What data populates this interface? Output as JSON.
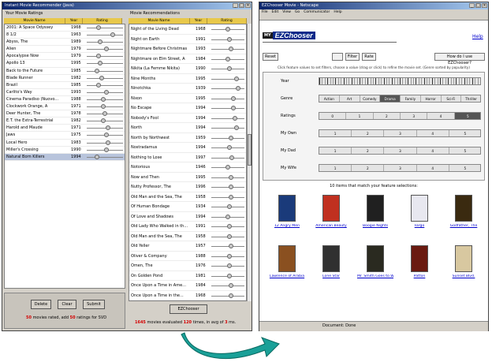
{
  "left_window": {
    "title": "Instant Movie Recommender (Java)",
    "your_ratings": {
      "heading": "Your Movie Ratings",
      "columns": [
        "Movie Name",
        "Year",
        "Rating"
      ],
      "rows": [
        {
          "name": "2001: A Space Odyssey",
          "year": "1968",
          "rating": 0.3
        },
        {
          "name": "8 1/2",
          "year": "1963",
          "rating": 0.75
        },
        {
          "name": "Abyss, The",
          "year": "1989",
          "rating": 0.35
        },
        {
          "name": "Alien",
          "year": "1979",
          "rating": 0.55
        },
        {
          "name": "Apocalypse Now",
          "year": "1979",
          "rating": 0.3
        },
        {
          "name": "Apollo 13",
          "year": "1995",
          "rating": 0.35
        },
        {
          "name": "Back to the Future",
          "year": "1985",
          "rating": 0.25
        },
        {
          "name": "Blade Runner",
          "year": "1982",
          "rating": 0.4
        },
        {
          "name": "Brazil",
          "year": "1985",
          "rating": 0.3
        },
        {
          "name": "Carlito's Way",
          "year": "1993",
          "rating": 0.55
        },
        {
          "name": "Cinema Paradiso (Nuovo...",
          "year": "1988",
          "rating": 0.45
        },
        {
          "name": "Clockwork Orange, A",
          "year": "1971",
          "rating": 0.45
        },
        {
          "name": "Deer Hunter, The",
          "year": "1978",
          "rating": 0.5
        },
        {
          "name": "E.T. the Extra-Terrestrial",
          "year": "1982",
          "rating": 0.45
        },
        {
          "name": "Harold and Maude",
          "year": "1971",
          "rating": 0.6
        },
        {
          "name": "Jaws",
          "year": "1975",
          "rating": 0.55
        },
        {
          "name": "Local Hero",
          "year": "1983",
          "rating": 0.6
        },
        {
          "name": "Miller's Crossing",
          "year": "1990",
          "rating": 0.55
        },
        {
          "name": "Natural Born Killers",
          "year": "1994",
          "rating": 0.25
        }
      ],
      "selected_index": 18
    },
    "recommendations": {
      "heading": "Movie Recommendations",
      "columns": [
        "Movie Name",
        "Year",
        "Rating"
      ],
      "rows": [
        {
          "name": "Night of the Living Dead",
          "year": "1968",
          "rating": 0.5
        },
        {
          "name": "Night on Earth",
          "year": "1991",
          "rating": 0.55
        },
        {
          "name": "Nightmare Before Christmas",
          "year": "1993",
          "rating": 0.6
        },
        {
          "name": "Nightmare on Elm Street, A",
          "year": "1984",
          "rating": 0.5
        },
        {
          "name": "Nikita (La Femme Nikita)",
          "year": "1990",
          "rating": 0.55
        },
        {
          "name": "Nine Months",
          "year": "1995",
          "rating": 0.8
        },
        {
          "name": "Ninotchka",
          "year": "1939",
          "rating": 0.85
        },
        {
          "name": "Nixon",
          "year": "1995",
          "rating": 0.7
        },
        {
          "name": "No Escape",
          "year": "1994",
          "rating": 0.7
        },
        {
          "name": "Nobody's Fool",
          "year": "1994",
          "rating": 0.75
        },
        {
          "name": "North",
          "year": "1994",
          "rating": 0.8
        },
        {
          "name": "North by Northwest",
          "year": "1959",
          "rating": 0.6
        },
        {
          "name": "Nostradamus",
          "year": "1994",
          "rating": 0.55
        },
        {
          "name": "Nothing to Lose",
          "year": "1997",
          "rating": 0.65
        },
        {
          "name": "Notorious",
          "year": "1946",
          "rating": 0.5
        },
        {
          "name": "Now and Then",
          "year": "1995",
          "rating": 0.6
        },
        {
          "name": "Nutty Professor, The",
          "year": "1996",
          "rating": 0.6
        },
        {
          "name": "Old Man and the Sea, The",
          "year": "1958",
          "rating": 0.6
        },
        {
          "name": "Of Human Bondage",
          "year": "1934",
          "rating": 0.55
        },
        {
          "name": "Of Love and Shadows",
          "year": "1994",
          "rating": 0.5
        },
        {
          "name": "Old Lady Who Walked in th...",
          "year": "1991",
          "rating": 0.55
        },
        {
          "name": "Old Man and the Sea, The",
          "year": "1958",
          "rating": 0.55
        },
        {
          "name": "Old Yeller",
          "year": "1957",
          "rating": 0.6
        },
        {
          "name": "Oliver & Company",
          "year": "1988",
          "rating": 0.55
        },
        {
          "name": "Omen, The",
          "year": "1976",
          "rating": 0.55
        },
        {
          "name": "On Golden Pond",
          "year": "1981",
          "rating": 0.55
        },
        {
          "name": "Once Upon a Time in Ame...",
          "year": "1984",
          "rating": 0.6
        },
        {
          "name": "Once Upon a Time in the...",
          "year": "1968",
          "rating": 0.6
        }
      ]
    },
    "buttons": {
      "delete": "Delete",
      "clear": "Clear",
      "submit": "Submit",
      "ezchooser": "EZChooser"
    },
    "status_left": {
      "n1": "50",
      "t1": "movies rated, add",
      "n2": "50",
      "t2": "ratings for SVD"
    },
    "status_right": {
      "n1": "1645",
      "t1": "movies evaluated",
      "n2": "120",
      "t2": "times, in avg of",
      "n3": "3",
      "t3": "ms."
    }
  },
  "right_window": {
    "title": "EZChooser Movie - Netscape",
    "menu": [
      "File",
      "Edit",
      "View",
      "Go",
      "Communicator",
      "Help"
    ],
    "logo": "EZChooser",
    "logo_prefix": "MY",
    "help_link": "Help",
    "buttons": {
      "reset": "Reset",
      "filter": "Filter",
      "rate": "Rate",
      "howto": "How do I use EZChooser?"
    },
    "instructions": "Click feature values to set filters, choose a value (drag or click) to refine the movie set. (Genre sorted by popularity)",
    "features": [
      {
        "label": "Year",
        "segments": []
      },
      {
        "label": "Genre",
        "segments": [
          "Action",
          "Art",
          "Comedy",
          "Drama",
          "Family",
          "Horror",
          "Sci-Fi",
          "Thriller"
        ],
        "selected": 3
      },
      {
        "label": "Ratings",
        "segments": [
          "0",
          "1",
          "2",
          "3",
          "4",
          "5"
        ],
        "selected": 5
      },
      {
        "label": "My Own",
        "segments": [
          "1",
          "2",
          "3",
          "4",
          "5"
        ]
      },
      {
        "label": "My Dad",
        "segments": [
          "1",
          "2",
          "3",
          "4",
          "5"
        ]
      },
      {
        "label": "My Wife",
        "segments": [
          "1",
          "2",
          "3",
          "4",
          "5"
        ]
      }
    ],
    "match_text": "10 items that match your feature selections:",
    "movies": [
      {
        "title": "12 Angry Men",
        "color": "#1a3a7a"
      },
      {
        "title": "American Beauty",
        "color": "#c03020"
      },
      {
        "title": "Boogie Nights",
        "color": "#202020"
      },
      {
        "title": "Fargo",
        "color": "#e8e8f0"
      },
      {
        "title": "Godfather, The",
        "color": "#3a2a10"
      },
      {
        "title": "Lawrence of Arabia",
        "color": "#8a5020"
      },
      {
        "title": "Lone Star",
        "color": "#303030"
      },
      {
        "title": "Mr. Smith Goes to Washington",
        "color": "#2a2a20"
      },
      {
        "title": "Patton",
        "color": "#6a1a10"
      },
      {
        "title": "Sunset Blvd.",
        "color": "#d8c8a0"
      }
    ],
    "status_bar": "Document: Done"
  },
  "colors": {
    "header_gold": "#e8c84a",
    "arrow_green": "#1aa098",
    "title_blue": "#0a246a"
  }
}
